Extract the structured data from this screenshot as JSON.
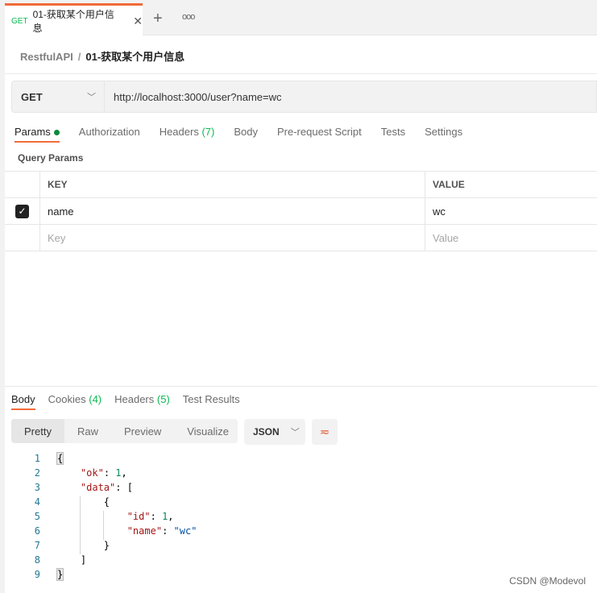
{
  "tab": {
    "method": "GET",
    "title": "01-获取某个用户信息"
  },
  "breadcrumb": {
    "parent": "RestfulAPI",
    "separator": "/",
    "current": "01-获取某个用户信息"
  },
  "request": {
    "method": "GET",
    "url": "http://localhost:3000/user?name=wc"
  },
  "request_tabs": [
    {
      "label": "Params",
      "active": true
    },
    {
      "label": "Authorization"
    },
    {
      "label": "Headers",
      "count": "(7)"
    },
    {
      "label": "Body"
    },
    {
      "label": "Pre-request Script"
    },
    {
      "label": "Tests"
    },
    {
      "label": "Settings"
    }
  ],
  "query_params": {
    "title": "Query Params",
    "headers": [
      "KEY",
      "VALUE"
    ],
    "rows": [
      {
        "checked": true,
        "key": "name",
        "value": "wc"
      }
    ],
    "placeholder": {
      "key": "Key",
      "value": "Value"
    }
  },
  "response_tabs": [
    {
      "label": "Body",
      "active": true
    },
    {
      "label": "Cookies",
      "count": "(4)"
    },
    {
      "label": "Headers",
      "count": "(5)"
    },
    {
      "label": "Test Results"
    }
  ],
  "view_modes": [
    "Pretty",
    "Raw",
    "Preview",
    "Visualize"
  ],
  "format": "JSON",
  "code_lines": [
    "1",
    "2",
    "3",
    "4",
    "5",
    "6",
    "7",
    "8",
    "9"
  ],
  "code": {
    "ok_key": "\"ok\"",
    "ok_val": "1",
    "data_key": "\"data\"",
    "id_key": "\"id\"",
    "id_val": "1",
    "name_key": "\"name\"",
    "name_val": "\"wc\""
  },
  "watermark": "CSDN @Modevol",
  "colors": {
    "accent": "#f26b3a",
    "green": "#0cbb52"
  }
}
